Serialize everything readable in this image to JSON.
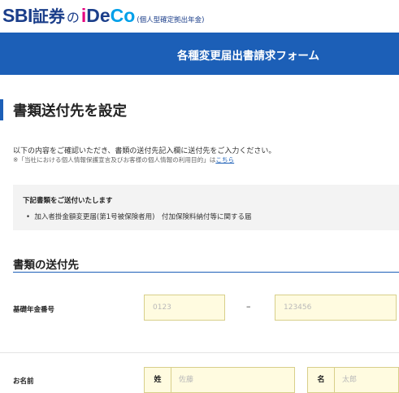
{
  "header": {
    "logo_sbi": "SBI",
    "logo_securities": "証券",
    "logo_no": "の",
    "logo_i": "i",
    "logo_de": "De",
    "logo_co": "Co",
    "logo_sub": "(個人型確定拠出年金)"
  },
  "banner": {
    "title": "各種変更届出書請求フォーム"
  },
  "page": {
    "title": "書類送付先を設定",
    "intro": "以下の内容をご確認いただき、書類の送付先記入欄に送付先をご入力ください。",
    "note_text": "※「当社における個人情報保護宣言及びお客様の個人情報の利用目的」は",
    "note_link": "こちら"
  },
  "info_box": {
    "heading": "下記書類をご送付いたします",
    "item": "加入者掛金額変更届(第1号被保険者用)　付加保険料納付等に関する届"
  },
  "section": {
    "title": "書類の送付先"
  },
  "form": {
    "pension_label": "基礎年金番号",
    "pension_part1_placeholder": "0123",
    "pension_dash": "–",
    "pension_part2_placeholder": "123456",
    "name_label": "お名前",
    "last_name_label": "姓",
    "last_name_placeholder": "佐藤",
    "first_name_label": "名",
    "first_name_placeholder": "太郎"
  },
  "colors": {
    "brand_blue": "#1c5fb7",
    "logo_navy": "#1b3e8a",
    "logo_pink": "#e6007e",
    "logo_cyan": "#00a0e9",
    "input_bg": "#fffbe0"
  }
}
